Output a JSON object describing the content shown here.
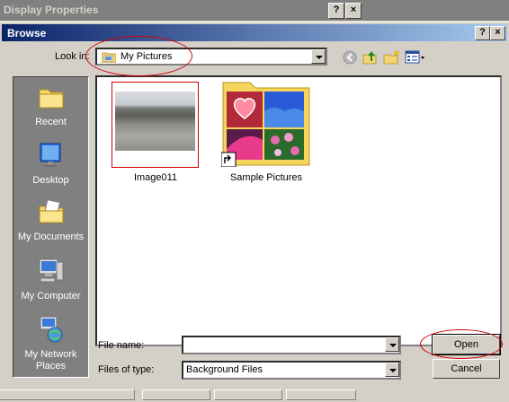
{
  "background_window": {
    "title": "Display Properties",
    "help_button": "?",
    "close_button": "×"
  },
  "dialog": {
    "title": "Browse",
    "help_button": "?",
    "close_button": "×",
    "look_in_label": "Look in:",
    "look_in_value": "My Pictures",
    "places": [
      {
        "label": "Recent",
        "icon": "recent-folder-icon"
      },
      {
        "label": "Desktop",
        "icon": "desktop-icon"
      },
      {
        "label": "My Documents",
        "icon": "my-documents-icon"
      },
      {
        "label": "My Computer",
        "icon": "my-computer-icon"
      },
      {
        "label": "My Network Places",
        "icon": "network-places-icon"
      }
    ],
    "files": [
      {
        "name": "Image011",
        "type": "image-thumbnail"
      },
      {
        "name": "Sample Pictures",
        "type": "folder-shortcut"
      }
    ],
    "file_name_label": "File name:",
    "file_name_value": "",
    "files_of_type_label": "Files of type:",
    "files_of_type_value": "Background Files",
    "open_button": "Open",
    "cancel_button": "Cancel"
  },
  "colors": {
    "title_active": "#0a246a",
    "title_gradient_end": "#a6caf0",
    "annotation": "#d40000",
    "face": "#d4d0c8"
  }
}
